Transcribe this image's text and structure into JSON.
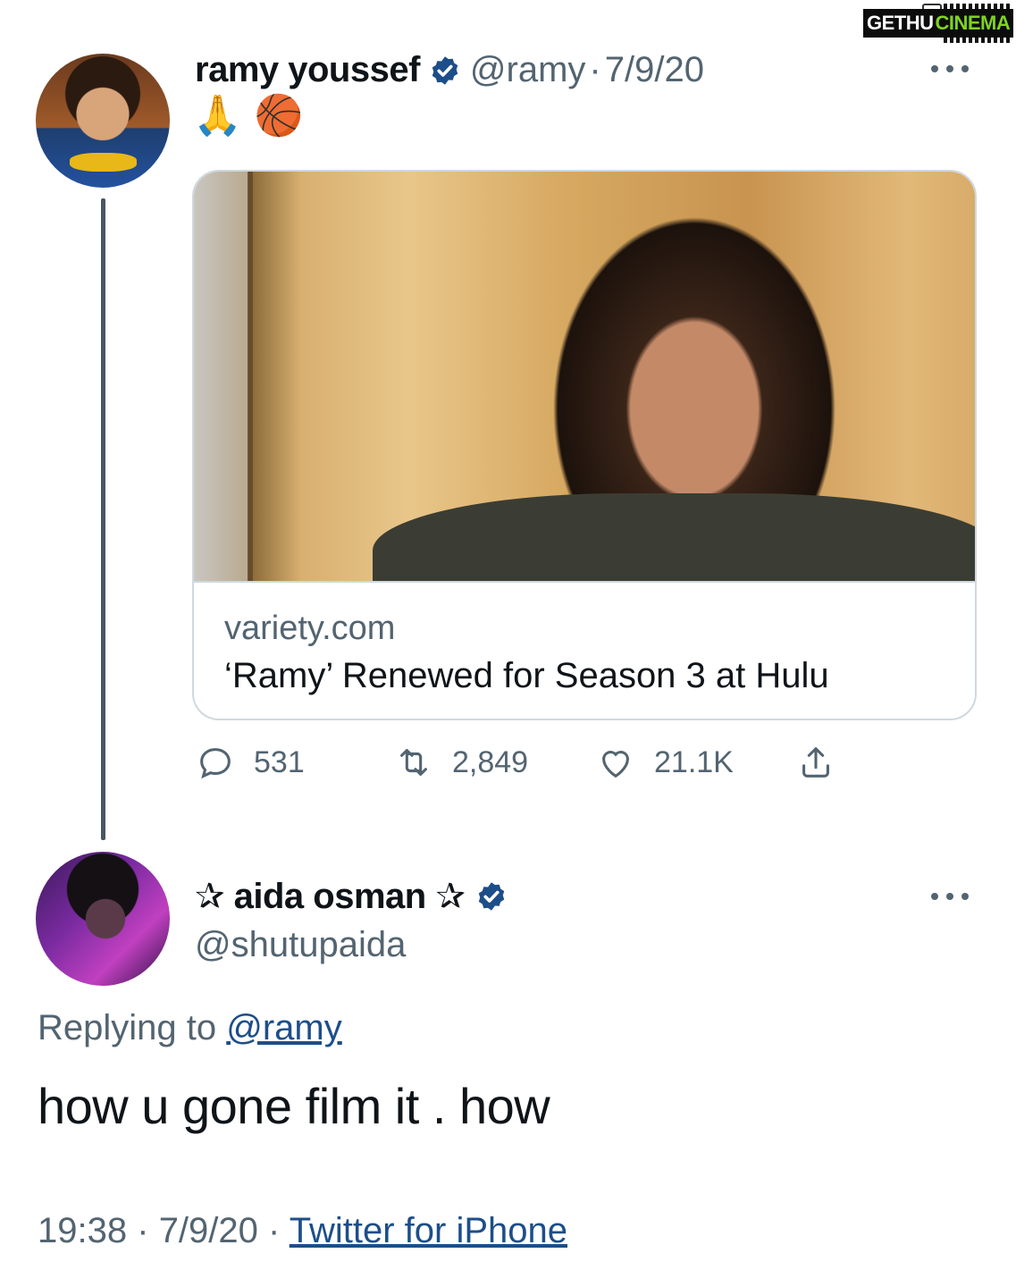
{
  "watermark": {
    "part1": "GETHU",
    "part2": "CINEMA"
  },
  "tweet": {
    "author_name": "ramy youssef",
    "handle": "@ramy",
    "separator": "·",
    "date": "7/9/20",
    "emoji1": "🙏",
    "emoji2": "🏀",
    "card": {
      "domain": "variety.com",
      "headline": "‘Ramy’ Renewed for Season 3 at Hulu"
    },
    "stats": {
      "replies": "531",
      "retweets": "2,849",
      "likes": "21.1K"
    }
  },
  "reply": {
    "author_name": "✰ aida osman ✰",
    "handle": "@shutupaida",
    "replying_prefix": "Replying to",
    "replying_handle": "@ramy",
    "text": "how u gone film it . how",
    "time": "19:38",
    "date": "7/9/20",
    "separator": "·",
    "source": "Twitter for iPhone"
  },
  "colors": {
    "verified": "#1d4e89",
    "link": "#1d4e89",
    "muted": "#536471",
    "thread_line": "#4b5664"
  }
}
